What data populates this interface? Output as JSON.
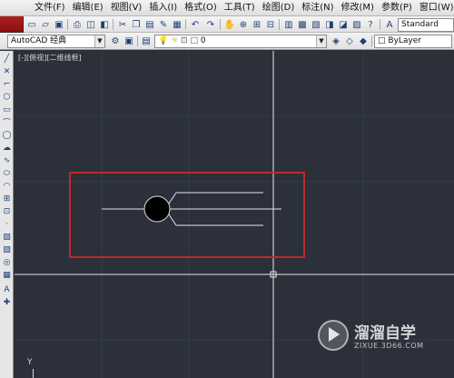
{
  "menubar": {
    "items": [
      "文件(F)",
      "编辑(E)",
      "视图(V)",
      "插入(I)",
      "格式(O)",
      "工具(T)",
      "绘图(D)",
      "标注(N)",
      "修改(M)",
      "参数(P)",
      "窗口(W)"
    ]
  },
  "toolbar2": {
    "workspace": "AutoCAD 经典",
    "layer_value": "0",
    "color_value": "ByLayer"
  },
  "toolbar1": {
    "text_style": "Standard"
  },
  "canvas": {
    "viewport_label": "[-][俯视][二维线框]",
    "ucs_y_label": "Y",
    "background_color": "#2b303a",
    "highlight_color": "#c0282a"
  },
  "watermark": {
    "brand": "溜溜自学",
    "url": "ZIXUE.3D66.COM"
  }
}
